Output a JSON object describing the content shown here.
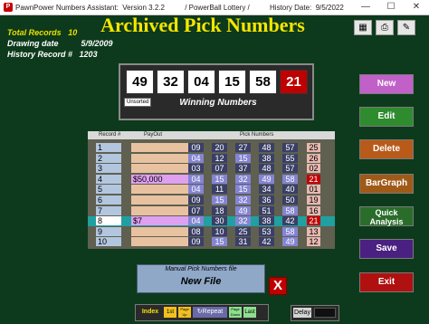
{
  "window": {
    "title": "PawnPower Numbers Assistant:  Version 3.2.2          / PowerBall Lottery /          History Date:  9/5/2022",
    "min_symbol": "—",
    "max_symbol": "☐",
    "close_symbol": "✕"
  },
  "stats": {
    "total_records_label": "Total Records",
    "total_records_value": "10",
    "drawing_date_label": "Drawing date",
    "drawing_date_value": "5/9/2009",
    "history_record_label": "History Record #",
    "history_record_value": "1203"
  },
  "header": {
    "title": "Archived Pick Numbers"
  },
  "winning": {
    "balls": [
      "49",
      "32",
      "04",
      "15",
      "58",
      "21"
    ],
    "unsorted_label": "Unsorted",
    "label": "Winning Numbers"
  },
  "grid": {
    "headers": [
      "Record #",
      "PayOut",
      "Pick Numbers"
    ],
    "rows": [
      {
        "record": "1",
        "payout": "",
        "nums": [
          "09",
          "20",
          "27",
          "48",
          "57"
        ],
        "hl": [
          false,
          false,
          false,
          false,
          false
        ],
        "pb": "25",
        "pb_hl": false,
        "selected": false
      },
      {
        "record": "2",
        "payout": "",
        "nums": [
          "04",
          "12",
          "15",
          "38",
          "55"
        ],
        "hl": [
          true,
          false,
          true,
          false,
          false
        ],
        "pb": "26",
        "pb_hl": false,
        "selected": false
      },
      {
        "record": "3",
        "payout": "",
        "nums": [
          "03",
          "07",
          "37",
          "48",
          "57"
        ],
        "hl": [
          false,
          false,
          false,
          false,
          false
        ],
        "pb": "02",
        "pb_hl": false,
        "selected": false
      },
      {
        "record": "4",
        "payout": "$50,000",
        "nums": [
          "04",
          "15",
          "32",
          "49",
          "58"
        ],
        "hl": [
          true,
          true,
          true,
          true,
          true
        ],
        "pb": "21",
        "pb_hl": true,
        "selected": false
      },
      {
        "record": "5",
        "payout": "",
        "nums": [
          "04",
          "11",
          "15",
          "34",
          "40"
        ],
        "hl": [
          true,
          false,
          true,
          false,
          false
        ],
        "pb": "01",
        "pb_hl": false,
        "selected": false
      },
      {
        "record": "6",
        "payout": "",
        "nums": [
          "09",
          "15",
          "32",
          "36",
          "50"
        ],
        "hl": [
          false,
          true,
          true,
          false,
          false
        ],
        "pb": "19",
        "pb_hl": false,
        "selected": false
      },
      {
        "record": "7",
        "payout": "",
        "nums": [
          "07",
          "18",
          "49",
          "51",
          "58"
        ],
        "hl": [
          false,
          false,
          true,
          false,
          true
        ],
        "pb": "16",
        "pb_hl": false,
        "selected": false
      },
      {
        "record": "8",
        "payout": "$7",
        "nums": [
          "04",
          "30",
          "32",
          "38",
          "42"
        ],
        "hl": [
          true,
          false,
          true,
          false,
          false
        ],
        "pb": "21",
        "pb_hl": true,
        "selected": true
      },
      {
        "record": "9",
        "payout": "",
        "nums": [
          "08",
          "10",
          "25",
          "53",
          "58"
        ],
        "hl": [
          false,
          false,
          false,
          false,
          true
        ],
        "pb": "13",
        "pb_hl": false,
        "selected": false
      },
      {
        "record": "10",
        "payout": "",
        "nums": [
          "09",
          "15",
          "31",
          "42",
          "49"
        ],
        "hl": [
          false,
          true,
          false,
          false,
          true
        ],
        "pb": "12",
        "pb_hl": false,
        "selected": false
      }
    ]
  },
  "file": {
    "label": "Manual Pick Numbers file",
    "name": "New File",
    "close_symbol": "X"
  },
  "side_buttons": [
    {
      "label": "New",
      "color": "#c060c8",
      "name": "new-button"
    },
    {
      "label": "Edit",
      "color": "#2e8b2e",
      "name": "edit-button"
    },
    {
      "label": "Delete",
      "color": "#b85a1a",
      "name": "delete-button"
    },
    {
      "label": "BarGraph",
      "color": "#a05a18",
      "name": "bargraph-button"
    },
    {
      "label": "Quick Analysis",
      "color": "#2a6d2a",
      "name": "quick-analysis-button"
    },
    {
      "label": "Save",
      "color": "#4a2080",
      "name": "save-button"
    },
    {
      "label": "Exit",
      "color": "#b01010",
      "name": "exit-button"
    }
  ],
  "bottom_bar": {
    "index": "Index",
    "first": "1st",
    "page_up": "Page Up",
    "repeat": "Repeat",
    "page_down": "Page Down",
    "last": "Last"
  },
  "delay": {
    "label": "Delay"
  },
  "colors": {
    "background": "#0d3a1c",
    "title_yellow": "#f5e500",
    "stats_yellow": "#e8e000",
    "match_highlight": "#8484d4",
    "powerball_match": "#c40000",
    "selected_row": "#20a0a0"
  }
}
